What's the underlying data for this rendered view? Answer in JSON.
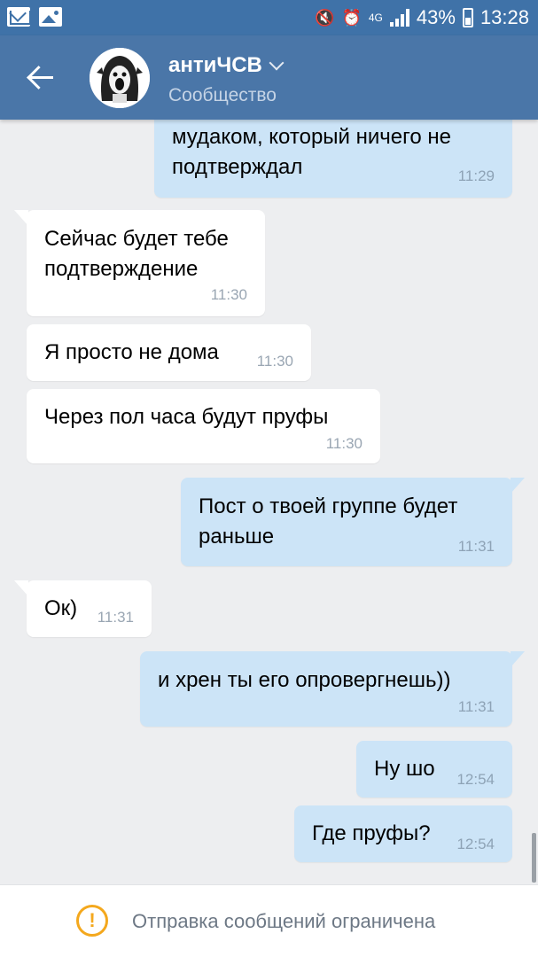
{
  "status_bar": {
    "battery": "43%",
    "time": "13:28",
    "network": "4G"
  },
  "header": {
    "title": "антиЧСВ",
    "subtitle": "Сообщество"
  },
  "messages": [
    {
      "dir": "out",
      "lines": [
        "мудаком, который ничего не",
        "подтверждал"
      ],
      "time": "11:29"
    },
    {
      "dir": "in",
      "lines": [
        "Сейчас будет тебе",
        "подтверждение"
      ],
      "time": "11:30"
    },
    {
      "dir": "in",
      "lines": [
        "Я просто не дома"
      ],
      "time": "11:30"
    },
    {
      "dir": "in",
      "lines": [
        "Через пол часа будут пруфы"
      ],
      "time": "11:30"
    },
    {
      "dir": "out",
      "lines": [
        "Пост о твоей группе будет",
        "раньше"
      ],
      "time": "11:31"
    },
    {
      "dir": "in",
      "lines": [
        "Ок)"
      ],
      "time": "11:31"
    },
    {
      "dir": "out",
      "lines": [
        "и хрен ты его опровергнешь))"
      ],
      "time": "11:31"
    },
    {
      "dir": "out",
      "lines": [
        "Ну шо"
      ],
      "time": "12:54"
    },
    {
      "dir": "out",
      "lines": [
        "Где пруфы?"
      ],
      "time": "12:54"
    }
  ],
  "footer": {
    "notice": "Отправка сообщений ограничена",
    "icon": "warning-icon",
    "icon_color": "#f4a81d"
  },
  "colors": {
    "header": "#4a76a8",
    "outgoing_bubble": "#cce4f7",
    "incoming_bubble": "#ffffff",
    "background": "#edeef0"
  }
}
